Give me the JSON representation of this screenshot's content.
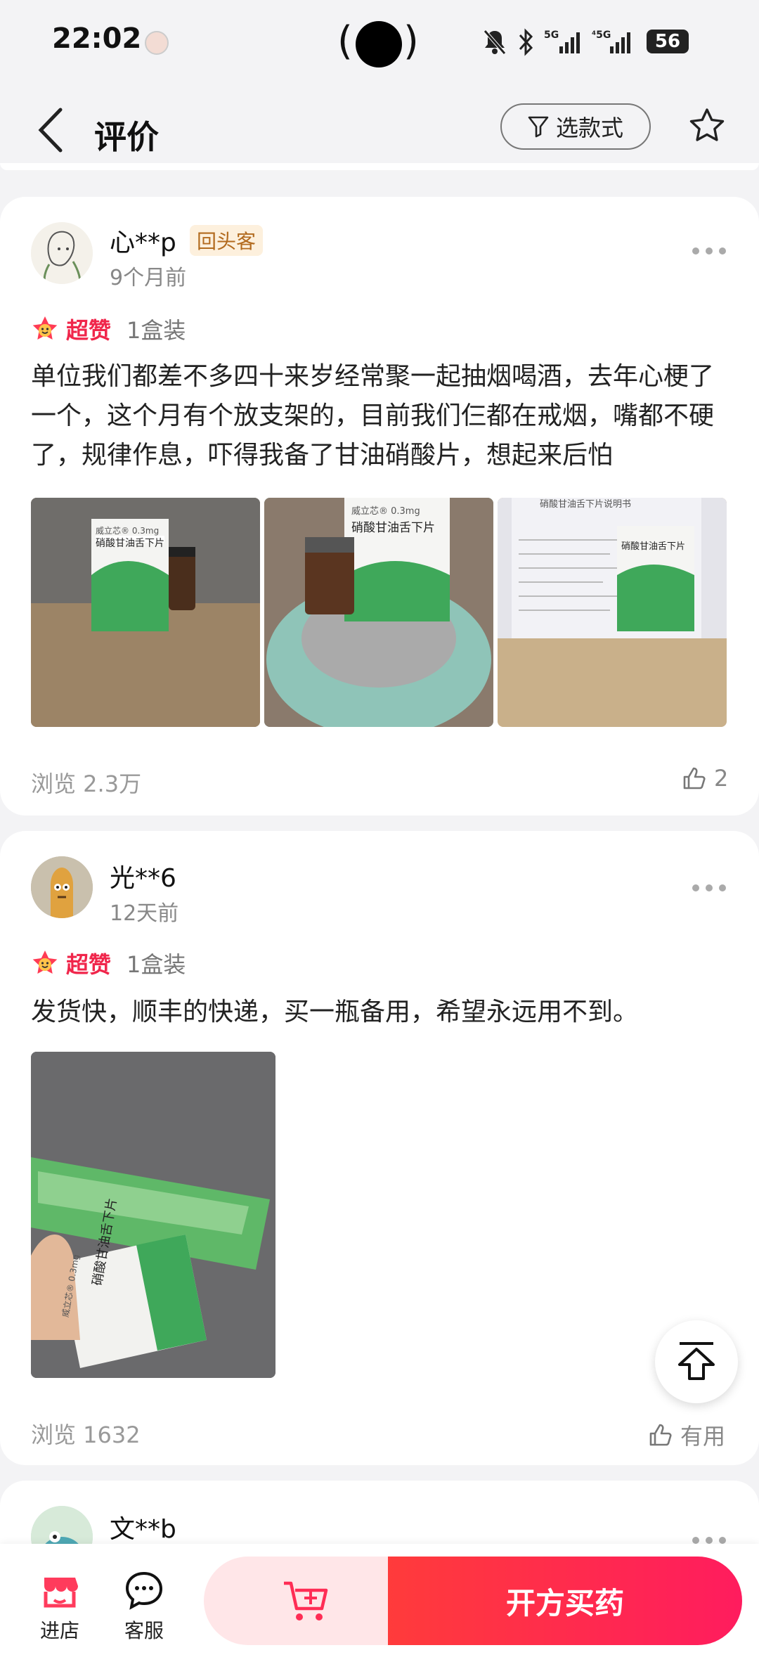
{
  "status_bar": {
    "time": "22:02",
    "battery": "56",
    "network": "5G"
  },
  "header": {
    "title": "评价",
    "filter_label": "选款式"
  },
  "reviews": [
    {
      "username": "心**p",
      "badge": "回头客",
      "time_ago": "9个月前",
      "rating_label": "超赞",
      "spec": "1盒装",
      "text": "单位我们都差不多四十来岁经常聚一起抽烟喝酒，去年心梗了一个，这个月有个放支架的，目前我们仨都在戒烟，嘴都不硬了，规律作息，吓得我备了甘油硝酸片，想起来后怕",
      "views": "浏览 2.3万",
      "likes": "2",
      "photos": [
        {
          "box_brand": "威立芯® 0.3mg",
          "box_name": "硝酸甘油舌下片"
        },
        {
          "box_brand": "威立芯® 0.3mg",
          "box_name": "硝酸甘油舌下片"
        },
        {
          "box_brand": "硝酸甘油舌下片说明书",
          "box_name": "硝酸甘油舌下片"
        }
      ]
    },
    {
      "username": "光**6",
      "time_ago": "12天前",
      "rating_label": "超赞",
      "spec": "1盒装",
      "text": "发货快，顺丰的快递，买一瓶备用，希望永远用不到。",
      "views": "浏览 1632",
      "likes": "有用",
      "photos": [
        {
          "box_brand": "威立芯® 0.3mg",
          "box_name": "硝酸甘油舌下片"
        }
      ]
    },
    {
      "username": "文**b"
    }
  ],
  "bottom_bar": {
    "shop_label": "进店",
    "service_label": "客服",
    "buy_label": "开方买药"
  },
  "colors": {
    "accent": "#f0264b",
    "buy_gradient_start": "#ff3b3b",
    "buy_gradient_end": "#ff1c5e"
  }
}
